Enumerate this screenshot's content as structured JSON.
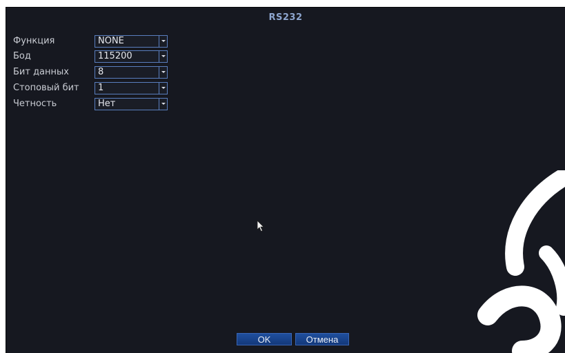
{
  "dialog": {
    "title": "RS232"
  },
  "fields": [
    {
      "label": "Функция",
      "value": "NONE"
    },
    {
      "label": "Бод",
      "value": "115200"
    },
    {
      "label": "Бит данных",
      "value": "8"
    },
    {
      "label": "Стоповый бит",
      "value": "1"
    },
    {
      "label": "Четность",
      "value": "Нет"
    }
  ],
  "buttons": {
    "ok_label": "OK",
    "cancel_label": "Отмена"
  },
  "colors": {
    "background": "#161820",
    "accent": "#5a7fbf",
    "title": "#8ea6cf",
    "button": "#1f4f9e"
  },
  "icons": {
    "dropdown": "chevron-down-icon",
    "cursor": "mouse-pointer-icon"
  }
}
